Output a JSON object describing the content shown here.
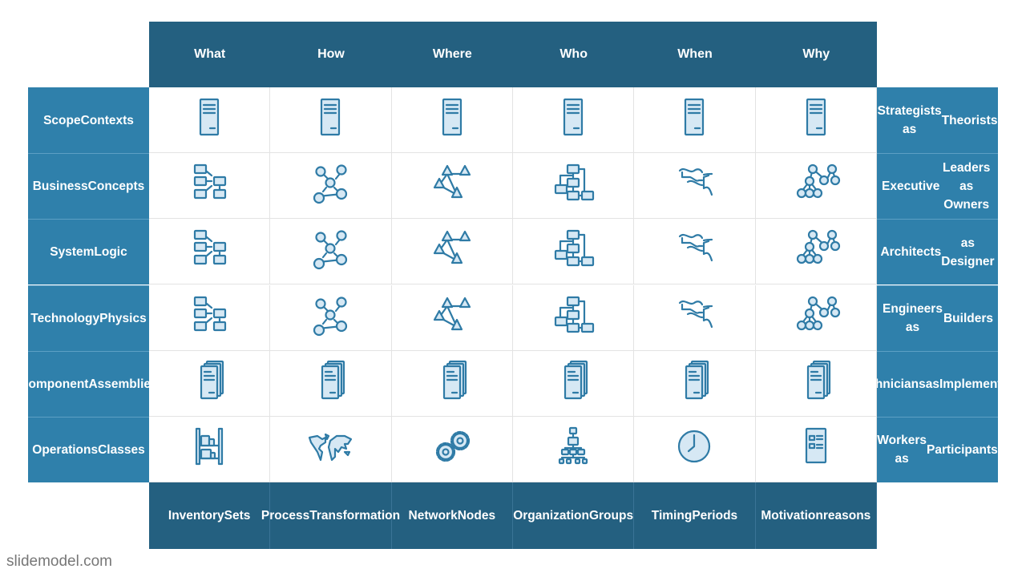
{
  "columns": [
    "What",
    "How",
    "Where",
    "Who",
    "When",
    "Why"
  ],
  "left_rows": [
    [
      "Scope",
      "Contexts"
    ],
    [
      "Business",
      "Concepts"
    ],
    [
      "System",
      "Logic"
    ],
    [
      "Technology",
      "Physics"
    ],
    [
      "Component",
      "Assemblies"
    ],
    [
      "Operations",
      "Classes"
    ]
  ],
  "right_rows": [
    [
      "Strategists as",
      "Theorists"
    ],
    [
      "Executive",
      "Leaders as Owners"
    ],
    [
      "Architects",
      "as Designer"
    ],
    [
      "Engineers as",
      "Builders"
    ],
    [
      "Technicians",
      "as",
      "Implementers"
    ],
    [
      "Workers as",
      "Participants"
    ]
  ],
  "footer": [
    [
      "Inventory",
      "Sets"
    ],
    [
      "Process",
      "Transformation"
    ],
    [
      "Network",
      "Nodes"
    ],
    [
      "Organization",
      "Groups"
    ],
    [
      "Timing",
      "Periods"
    ],
    [
      "Motivation",
      "reasons"
    ]
  ],
  "cells": [
    [
      "document-icon",
      "document-icon",
      "document-icon",
      "document-icon",
      "document-icon",
      "document-icon"
    ],
    [
      "flowchart-icon",
      "node-network-icon",
      "triangle-network-icon",
      "org-tree-icon",
      "river-map-icon",
      "circle-tree-icon"
    ],
    [
      "flowchart-icon",
      "node-network-icon",
      "triangle-network-icon",
      "org-tree-icon",
      "river-map-icon",
      "circle-tree-icon"
    ],
    [
      "flowchart-icon",
      "node-network-icon",
      "triangle-network-icon",
      "org-tree-icon",
      "river-map-icon",
      "circle-tree-icon"
    ],
    [
      "documents-stack-icon",
      "documents-stack-icon",
      "documents-stack-icon",
      "documents-stack-icon",
      "documents-stack-icon",
      "documents-stack-icon"
    ],
    [
      "shelf-icon",
      "world-map-icon",
      "gears-icon",
      "hierarchy-icon",
      "clock-icon",
      "checklist-icon"
    ]
  ],
  "brand": "slidemodel.com",
  "colors": {
    "header": "#246080",
    "side": "#2f80ab",
    "icon_stroke": "#2f7ba6",
    "icon_fill": "#d6e8f4"
  }
}
